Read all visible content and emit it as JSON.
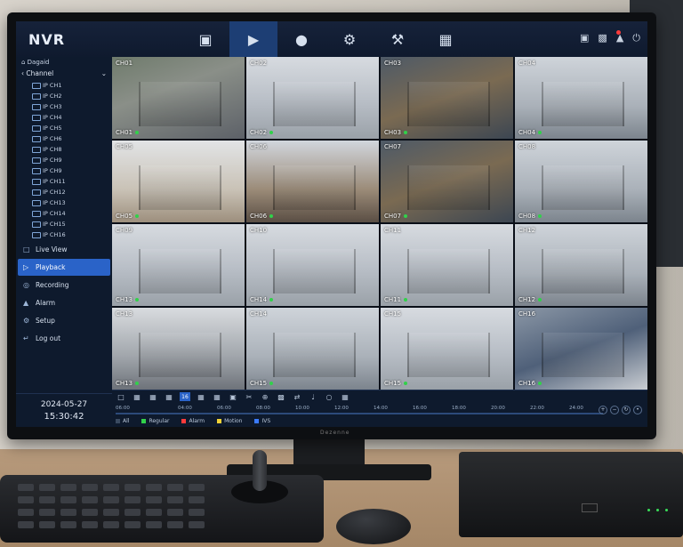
{
  "app": {
    "title": "NVR"
  },
  "topnav": [
    {
      "name": "camera-icon",
      "glyph": "▣"
    },
    {
      "name": "playback-icon",
      "glyph": "▶",
      "active": true
    },
    {
      "name": "record-icon",
      "glyph": "●"
    },
    {
      "name": "gear-icon",
      "glyph": "⚙"
    },
    {
      "name": "tools-icon",
      "glyph": "⚒"
    },
    {
      "name": "grid-icon",
      "glyph": "▦"
    }
  ],
  "topright": {
    "alarm_icon": "bell-icon",
    "power_icon": "power-icon"
  },
  "sidebar": {
    "top_label": "Dagaid",
    "channel_header": "Channel",
    "group_label": "IP CH1",
    "channels": [
      "IP CH1",
      "IP CH2",
      "IP CH3",
      "IP CH4",
      "IP CH5",
      "IP CH6",
      "IP CH8",
      "IP CH9",
      "IP CH9",
      "IP CH11",
      "IP CH12",
      "IP CH13",
      "IP CH14",
      "IP CH15",
      "IP CH16"
    ],
    "menu": [
      {
        "label": "Live View",
        "icon": "monitor-icon",
        "glyph": "□"
      },
      {
        "label": "Playback",
        "icon": "playback-icon",
        "glyph": "▷",
        "active": true
      },
      {
        "label": "Recording",
        "icon": "record-icon",
        "glyph": "◎"
      },
      {
        "label": "Alarm",
        "icon": "bell-icon",
        "glyph": "▲"
      },
      {
        "label": "Setup",
        "icon": "gear-icon",
        "glyph": "⚙"
      },
      {
        "label": "Log out",
        "icon": "logout-icon",
        "glyph": "↵"
      }
    ],
    "date": "2024-05-27",
    "time": "15:30:42"
  },
  "tiles": [
    {
      "top": "CH01",
      "bottom": "CH01",
      "scene": "v-parking"
    },
    {
      "top": "CH02",
      "bottom": "CH02",
      "scene": "v-hall"
    },
    {
      "top": "CH03",
      "bottom": "CH03",
      "scene": "v-ware"
    },
    {
      "top": "CH04",
      "bottom": "CH04",
      "scene": "v-office"
    },
    {
      "top": "CH05",
      "bottom": "CH05",
      "scene": "v-lobby"
    },
    {
      "top": "CH06",
      "bottom": "CH06",
      "scene": "v-meet"
    },
    {
      "top": "CH07",
      "bottom": "CH07",
      "scene": "v-ware"
    },
    {
      "top": "CH08",
      "bottom": "CH08",
      "scene": "v-office"
    },
    {
      "top": "CH09",
      "bottom": "CH13",
      "scene": "v-hall"
    },
    {
      "top": "CH10",
      "bottom": "CH14",
      "scene": "v-hall"
    },
    {
      "top": "CH11",
      "bottom": "CH11",
      "scene": "v-hall"
    },
    {
      "top": "CH12",
      "bottom": "CH12",
      "scene": "v-office"
    },
    {
      "top": "CH13",
      "bottom": "CH13",
      "scene": "v-stairs"
    },
    {
      "top": "CH14",
      "bottom": "CH15",
      "scene": "v-office"
    },
    {
      "top": "CH15",
      "bottom": "CH15",
      "scene": "v-hall"
    },
    {
      "top": "CH16",
      "bottom": "CH16",
      "scene": "v-shelves"
    }
  ],
  "timeline": {
    "start_label": "06:00",
    "tool_active_label": "16",
    "ticks": [
      "04:00",
      "06:00",
      "08:00",
      "10:00",
      "12:00",
      "14:00",
      "16:00",
      "18:00",
      "20:00",
      "22:00",
      "24:00"
    ],
    "legend": [
      {
        "label": "All",
        "color": "#3a4a60"
      },
      {
        "label": "Regular",
        "color": "#31d14a"
      },
      {
        "label": "Alarm",
        "color": "#ff3b3b"
      },
      {
        "label": "Motion",
        "color": "#f1d236"
      },
      {
        "label": "IVS",
        "color": "#3b7bff"
      }
    ]
  },
  "hardware": {
    "monitor_brand": "Dezenne"
  }
}
